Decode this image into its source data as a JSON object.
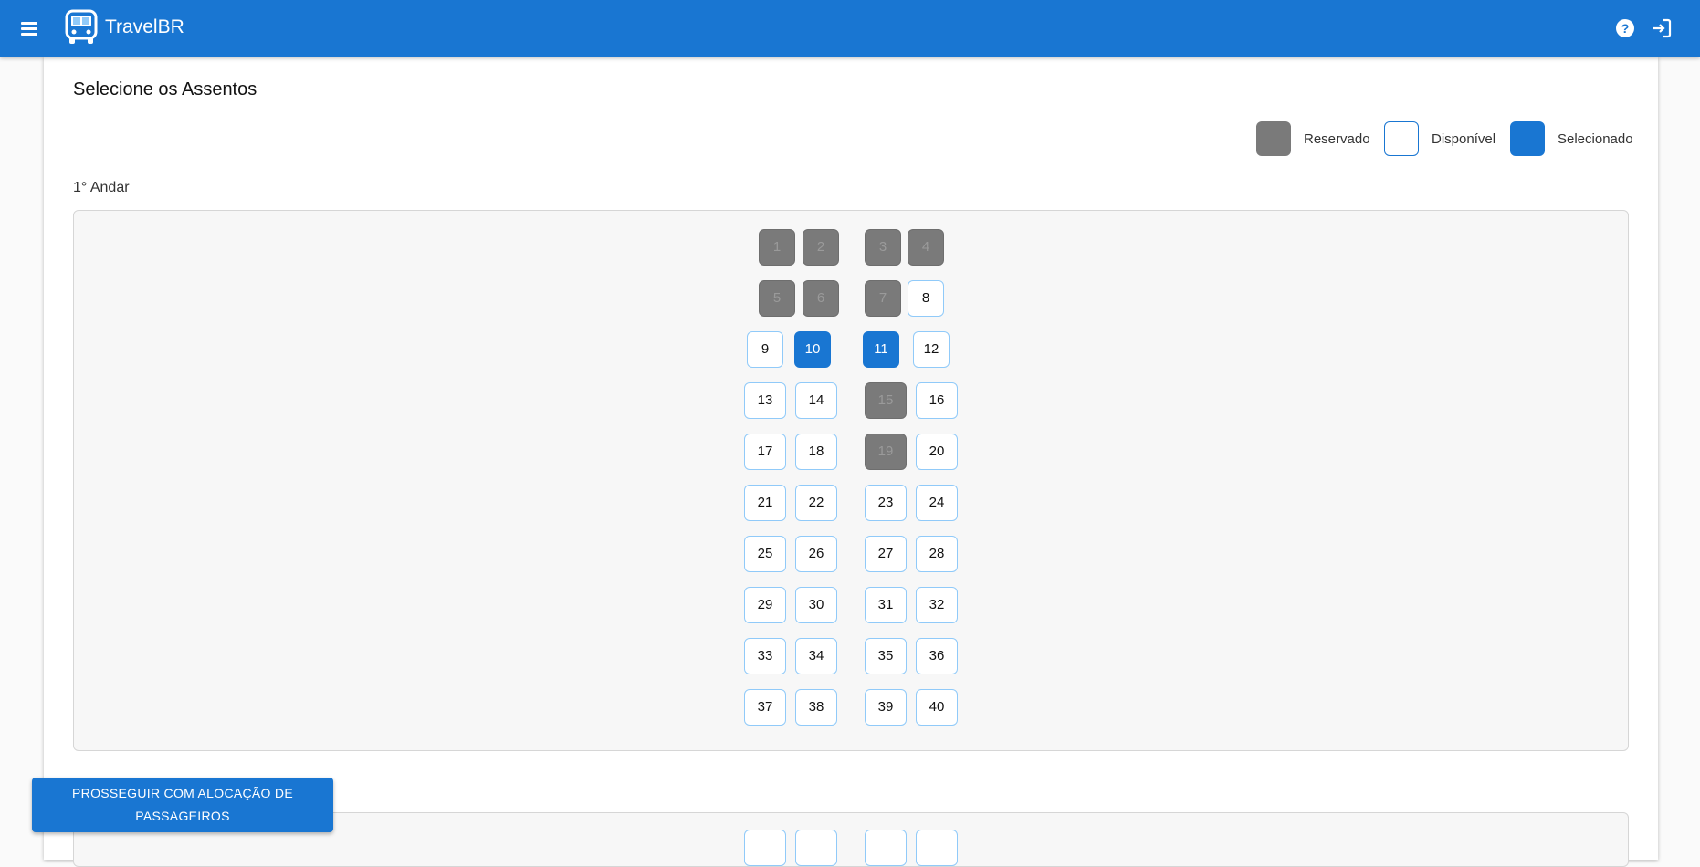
{
  "header": {
    "app_title": "TravelBR",
    "icons": {
      "menu": "menu-icon",
      "logo": "bus-icon",
      "help": "help-icon",
      "logout": "logout-icon"
    },
    "brand_color": "#1976d2"
  },
  "page": {
    "title": "Selecione os Assentos"
  },
  "legend": [
    {
      "state": "reserved",
      "label": "Reservado",
      "color": "#7a7a7a"
    },
    {
      "state": "available",
      "label": "Disponível",
      "color": "#ffffff"
    },
    {
      "state": "selected",
      "label": "Selecionado",
      "color": "#1976d2"
    }
  ],
  "floors": [
    {
      "label": "1° Andar",
      "rows": [
        [
          {
            "n": "1",
            "s": "reserved"
          },
          {
            "n": "2",
            "s": "reserved"
          },
          {
            "n": "3",
            "s": "reserved"
          },
          {
            "n": "4",
            "s": "reserved"
          }
        ],
        [
          {
            "n": "5",
            "s": "reserved"
          },
          {
            "n": "6",
            "s": "reserved"
          },
          {
            "n": "7",
            "s": "reserved"
          },
          {
            "n": "8",
            "s": "available"
          }
        ],
        [
          {
            "n": "9",
            "s": "available"
          },
          {
            "n": "10",
            "s": "selected"
          },
          {
            "n": "11",
            "s": "selected"
          },
          {
            "n": "12",
            "s": "available"
          }
        ],
        [
          {
            "n": "13",
            "s": "available"
          },
          {
            "n": "14",
            "s": "available"
          },
          {
            "n": "15",
            "s": "reserved"
          },
          {
            "n": "16",
            "s": "available"
          }
        ],
        [
          {
            "n": "17",
            "s": "available"
          },
          {
            "n": "18",
            "s": "available"
          },
          {
            "n": "19",
            "s": "reserved"
          },
          {
            "n": "20",
            "s": "available"
          }
        ],
        [
          {
            "n": "21",
            "s": "available"
          },
          {
            "n": "22",
            "s": "available"
          },
          {
            "n": "23",
            "s": "available"
          },
          {
            "n": "24",
            "s": "available"
          }
        ],
        [
          {
            "n": "25",
            "s": "available"
          },
          {
            "n": "26",
            "s": "available"
          },
          {
            "n": "27",
            "s": "available"
          },
          {
            "n": "28",
            "s": "available"
          }
        ],
        [
          {
            "n": "29",
            "s": "available"
          },
          {
            "n": "30",
            "s": "available"
          },
          {
            "n": "31",
            "s": "available"
          },
          {
            "n": "32",
            "s": "available"
          }
        ],
        [
          {
            "n": "33",
            "s": "available"
          },
          {
            "n": "34",
            "s": "available"
          },
          {
            "n": "35",
            "s": "available"
          },
          {
            "n": "36",
            "s": "available"
          }
        ],
        [
          {
            "n": "37",
            "s": "available"
          },
          {
            "n": "38",
            "s": "available"
          },
          {
            "n": "39",
            "s": "available"
          },
          {
            "n": "40",
            "s": "available"
          }
        ]
      ]
    }
  ],
  "actions": {
    "proceed_label": "PROSSEGUIR COM ALOCAÇÃO DE PASSAGEIROS"
  }
}
